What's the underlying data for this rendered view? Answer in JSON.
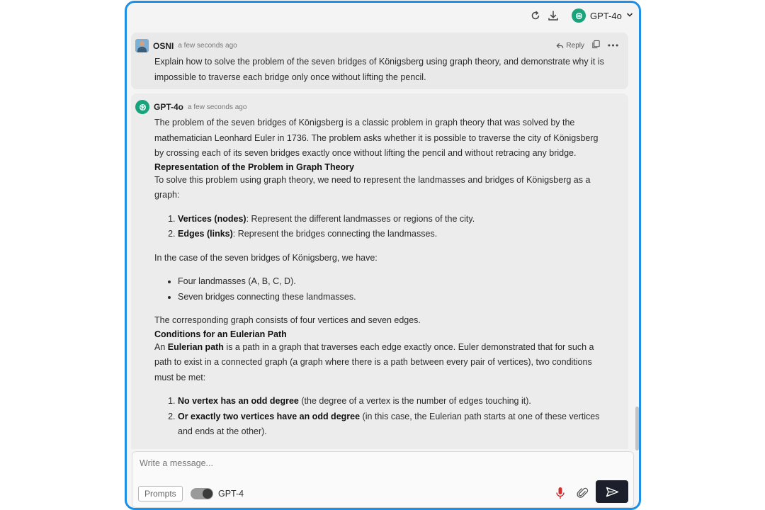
{
  "topbar": {
    "model_name": "GPT-4o",
    "icons": [
      "refresh-icon",
      "download-icon",
      "openai-logo-icon",
      "chevron-down-icon"
    ]
  },
  "user_message": {
    "author": "OSNI",
    "time": "a few seconds ago",
    "reply_label": "Reply",
    "text": "Explain how to solve the problem of the seven bridges of Königsberg using graph theory, and demonstrate why it is impossible to traverse each bridge only once without lifting the pencil."
  },
  "ai_message": {
    "author": "GPT-4o",
    "time": "a few seconds ago",
    "intro": "The problem of the seven bridges of Königsberg is a classic problem in graph theory that was solved by the mathematician Leonhard Euler in 1736. The problem asks whether it is possible to traverse the city of Königsberg by crossing each of its seven bridges exactly once without lifting the pencil and without retracing any bridge.",
    "heading1": "Representation of the Problem in Graph Theory",
    "para1": "To solve this problem using graph theory, we need to represent the landmasses and bridges of Königsberg as a graph:",
    "list1": [
      {
        "bold": "Vertices (nodes)",
        "text": ": Represent the different landmasses or regions of the city."
      },
      {
        "bold": "Edges (links)",
        "text": ": Represent the bridges connecting the landmasses."
      }
    ],
    "para2": "In the case of the seven bridges of Königsberg, we have:",
    "list2": [
      "Four landmasses (A, B, C, D).",
      "Seven bridges connecting these landmasses."
    ],
    "para3": "The corresponding graph consists of four vertices and seven edges.",
    "heading2": "Conditions for an Eulerian Path",
    "para4_pre": "An ",
    "para4_bold": "Eulerian path",
    "para4_post": " is a path in a graph that traverses each edge exactly once. Euler demonstrated that for such a path to exist in a connected graph (a graph where there is a path between every pair of vertices), two conditions must be met:",
    "list3": [
      {
        "bold": "No vertex has an odd degree",
        "text": " (the degree of a vertex is the number of edges touching it)."
      },
      {
        "bold": "Or exactly two vertices have an odd degree",
        "text": " (in this case, the Eulerian path starts at one of these vertices and ends at the other)."
      }
    ]
  },
  "composer": {
    "placeholder": "Write a message...",
    "prompts_label": "Prompts",
    "toggle_label": "GPT-4",
    "toggle_on": true
  },
  "colors": {
    "frame_border": "#1f8fe6",
    "send_button": "#1c1f2b",
    "mic": "#d32f2f",
    "gpt_logo": "#19a37c"
  }
}
